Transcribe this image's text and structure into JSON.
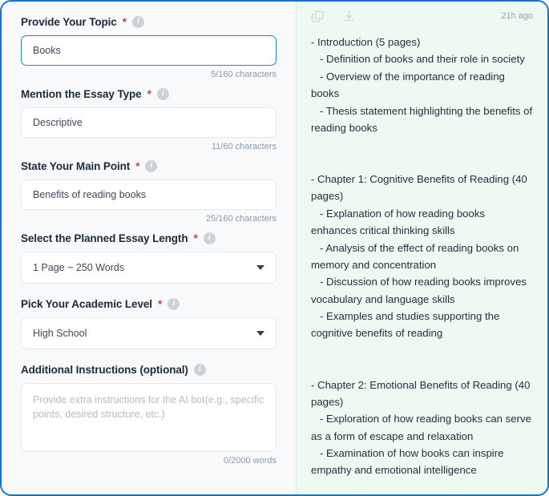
{
  "theme": {
    "card_border": "#1573cf",
    "form_bg": "#f7f9fb",
    "result_bg": "#eefaf1",
    "label_color": "#1c2b3a",
    "required_color": "#e0393e",
    "focus_border": "#2d7fd3",
    "counter_color": "#8b9bb0"
  },
  "form": {
    "fields": [
      {
        "label": "Provide Your Topic",
        "required": true,
        "required_mark": "*",
        "info_icon": "info-icon",
        "info_glyph": "i",
        "type": "text",
        "value": "Books",
        "placeholder": "",
        "counter": "5/160 characters",
        "focused": true
      },
      {
        "label": "Mention the Essay Type",
        "required": true,
        "required_mark": "*",
        "info_icon": "info-icon",
        "info_glyph": "i",
        "type": "text",
        "value": "Descriptive",
        "placeholder": "",
        "counter": "11/60 characters",
        "focused": false
      },
      {
        "label": "State Your Main Point",
        "required": true,
        "required_mark": "*",
        "info_icon": "info-icon",
        "info_glyph": "i",
        "type": "text",
        "value": "Benefits of reading books",
        "placeholder": "",
        "counter": "25/160 characters",
        "focused": false
      },
      {
        "label": "Select the Planned Essay Length",
        "required": true,
        "required_mark": "*",
        "info_icon": "info-icon",
        "info_glyph": "i",
        "type": "select",
        "value": "1 Page ~ 250 Words",
        "counter": "",
        "focused": false
      },
      {
        "label": "Pick Your Academic Level",
        "required": true,
        "required_mark": "*",
        "info_icon": "info-icon",
        "info_glyph": "i",
        "type": "select",
        "value": "High School",
        "counter": "",
        "focused": false
      },
      {
        "label": "Additional Instructions (optional)",
        "required": false,
        "required_mark": "",
        "info_icon": "info-icon",
        "info_glyph": "i",
        "type": "textarea",
        "value": "",
        "placeholder": "Provide extra instructions for the AI bot(e.g., specific points, desired structure, etc.)",
        "counter": "0/2000 words",
        "focused": false
      }
    ]
  },
  "result": {
    "toolbar": {
      "copy_icon": "copy-icon",
      "download_icon": "download-icon",
      "timestamp": "21h ago"
    },
    "content": "- Introduction (5 pages)\n   - Definition of books and their role in society\n   - Overview of the importance of reading books\n   - Thesis statement highlighting the benefits of reading books\n\n\n- Chapter 1: Cognitive Benefits of Reading (40 pages)\n   - Explanation of how reading books enhances critical thinking skills\n   - Analysis of the effect of reading books on memory and concentration\n   - Discussion of how reading books improves vocabulary and language skills\n   - Examples and studies supporting the cognitive benefits of reading\n\n\n- Chapter 2: Emotional Benefits of Reading (40 pages)\n   - Exploration of how reading books can serve as a form of escape and relaxation\n   - Examination of how books can inspire empathy and emotional intelligence"
  }
}
